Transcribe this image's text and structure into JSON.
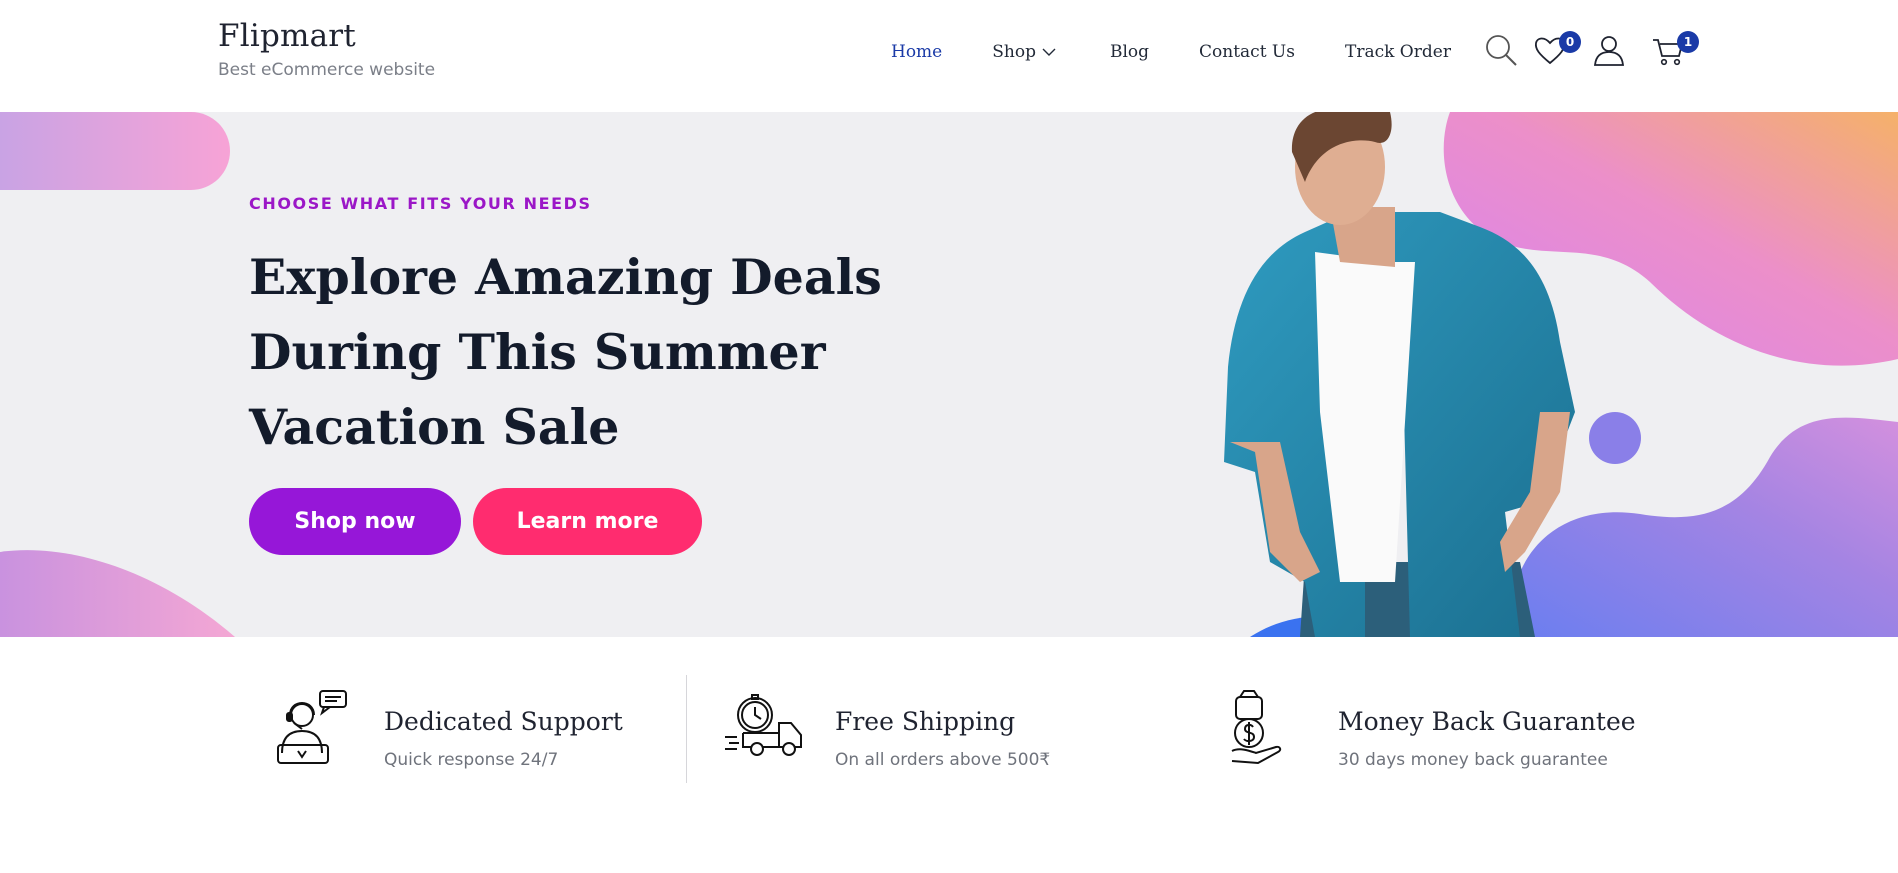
{
  "brand": {
    "name": "Flipmart",
    "tagline": "Best eCommerce website"
  },
  "nav": {
    "home": "Home",
    "shop": "Shop",
    "blog": "Blog",
    "contact": "Contact Us",
    "track": "Track Order",
    "active_color": "#1a3aa7"
  },
  "tools": {
    "wishlist_count": "0",
    "cart_count": "1",
    "icons": [
      "search-icon",
      "heart-icon",
      "user-icon",
      "cart-icon"
    ]
  },
  "hero": {
    "eyebrow": "CHOOSE WHAT FITS YOUR NEEDS",
    "headline": "Explore Amazing Deals During This Summer Vacation Sale",
    "primary_button": "Shop now",
    "secondary_button": "Learn more",
    "colors": {
      "primary": "#9617d8",
      "secondary": "#ff2c6f",
      "eyebrow": "#9b17c7"
    }
  },
  "features": [
    {
      "icon": "support-agent-icon",
      "title": "Dedicated Support",
      "subtitle": "Quick response 24/7"
    },
    {
      "icon": "delivery-truck-icon",
      "title": "Free Shipping",
      "subtitle": "On all orders above 500₹"
    },
    {
      "icon": "money-back-icon",
      "title": "Money Back Guarantee",
      "subtitle": "30 days money back guarantee"
    }
  ]
}
